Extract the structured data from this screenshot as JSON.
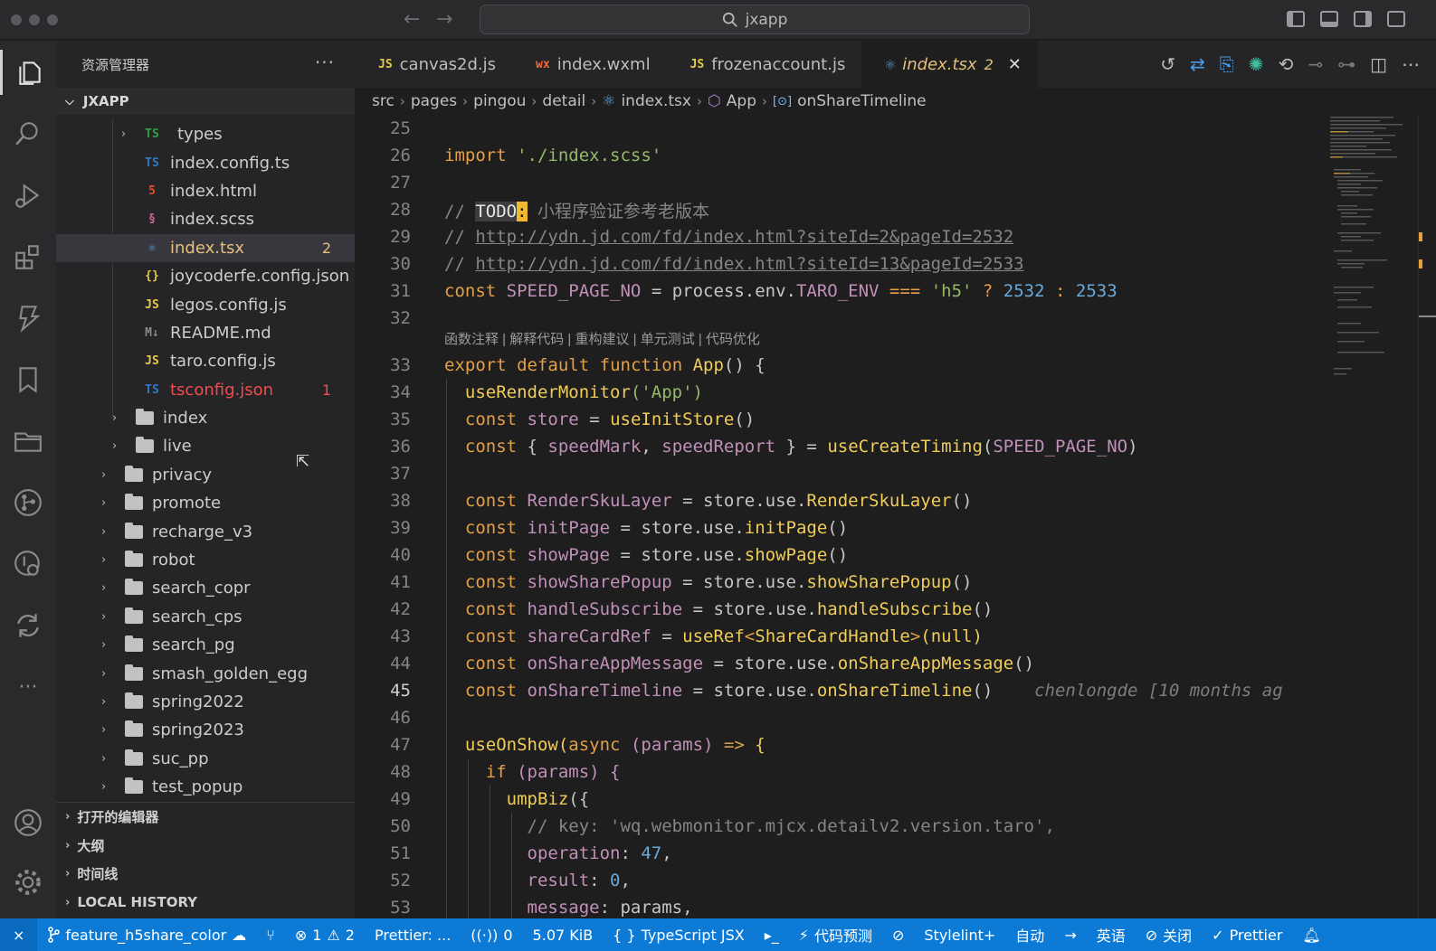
{
  "window": {
    "title": "jxapp"
  },
  "sidebar": {
    "title": "资源管理器",
    "more": "···",
    "root": "JXAPP",
    "items": [
      {
        "label": "types",
        "kind": "folder-ts",
        "icon": "TS",
        "color": "#cccccc"
      },
      {
        "label": "index.config.ts",
        "kind": "ts",
        "icon": "TS",
        "color": "#cccccc"
      },
      {
        "label": "index.html",
        "kind": "html",
        "icon": "5",
        "color": "#cccccc"
      },
      {
        "label": "index.scss",
        "kind": "scss",
        "icon": "§",
        "color": "#cccccc"
      },
      {
        "label": "index.tsx",
        "kind": "react",
        "icon": "⚛",
        "color": "#e5c07b",
        "badge": "2"
      },
      {
        "label": "joycoderfe.config.json",
        "kind": "json",
        "icon": "{}",
        "color": "#cccccc"
      },
      {
        "label": "legos.config.js",
        "kind": "js",
        "icon": "JS",
        "color": "#cccccc"
      },
      {
        "label": "README.md",
        "kind": "md",
        "icon": "M↓",
        "color": "#cccccc"
      },
      {
        "label": "taro.config.js",
        "kind": "js",
        "icon": "JS",
        "color": "#cccccc"
      },
      {
        "label": "tsconfig.json",
        "kind": "tsconfig",
        "icon": "TS",
        "color": "#f14c4c",
        "badge": "1"
      }
    ],
    "folders_l3": [
      "index",
      "live"
    ],
    "folders_l2": [
      "privacy",
      "promote",
      "recharge_v3",
      "robot",
      "search_copr",
      "search_cps",
      "search_pg",
      "smash_golden_egg",
      "spring2022",
      "spring2023",
      "suc_pp",
      "test_popup"
    ],
    "sections": [
      "打开的编辑器",
      "大纲",
      "时间线",
      "LOCAL HISTORY"
    ]
  },
  "tabs": [
    {
      "label": "canvas2d.js",
      "icon": "JS"
    },
    {
      "label": "index.wxml",
      "icon": "wx"
    },
    {
      "label": "frozenaccount.js",
      "icon": "JS"
    },
    {
      "label": "index.tsx",
      "icon": "⚛",
      "badge": "2",
      "active": true
    }
  ],
  "breadcrumb": [
    "src",
    "pages",
    "pingou",
    "detail",
    "index.tsx",
    "App",
    "onShareTimeline"
  ],
  "editor": {
    "codelens": "函数注释 | 解释代码 | 重构建议 | 单元测试 | 代码优化",
    "blame": "chenlongde [10 months ag",
    "line_numbers": [
      "25",
      "26",
      "27",
      "28",
      "29",
      "30",
      "31",
      "32",
      "33",
      "34",
      "35",
      "36",
      "37",
      "38",
      "39",
      "40",
      "41",
      "42",
      "43",
      "44",
      "45",
      "46",
      "47",
      "48",
      "49",
      "50",
      "51",
      "52",
      "53"
    ],
    "current_line": "45",
    "lines": {
      "l26": {
        "kw": "import",
        "str": "'./index.scss'"
      },
      "l28": {
        "cmt": "// ",
        "todo": "TODO",
        "colon": ":",
        "rest": " 小程序验证参考老版本"
      },
      "l29": {
        "cmt": "// ",
        "url": "http://ydn.jd.com/fd/index.html?siteId=2&pageId=2532"
      },
      "l30": {
        "cmt": "// ",
        "url": "http://ydn.jd.com/fd/index.html?siteId=13&pageId=2533"
      },
      "l31": {
        "kw": "const",
        "name": "SPEED_PAGE_NO",
        "eq": " = process.env.",
        "env": "TARO_ENV",
        "op": " === ",
        "str": "'h5'",
        "q": " ? ",
        "n1": "2532",
        "c": " : ",
        "n2": "2533"
      },
      "l33": {
        "kw1": "export",
        "kw2": "default",
        "kw3": "function",
        "fn": "App",
        "rest": "() {"
      },
      "l34": {
        "fn": "useRenderMonitor",
        "str": "('App')"
      },
      "l35": {
        "kw": "const",
        "var": "store",
        "eq": " = ",
        "fn": "useInitStore",
        "rest": "()"
      },
      "l36": {
        "kw": "const",
        "open": " { ",
        "v1": "speedMark",
        "comma": ", ",
        "v2": "speedReport",
        "close": " } = ",
        "fn": "useCreateTiming",
        "lp": "(",
        "arg": "SPEED_PAGE_NO",
        "rp": ")"
      },
      "l38": {
        "kw": "const",
        "var": "RenderSkuLayer",
        "eq": " = store.use.",
        "fn": "RenderSkuLayer",
        "rest": "()"
      },
      "l39": {
        "kw": "const",
        "var": "initPage",
        "eq": " = store.use.",
        "fn": "initPage",
        "rest": "()"
      },
      "l40": {
        "kw": "const",
        "var": "showPage",
        "eq": " = store.use.",
        "fn": "showPage",
        "rest": "()"
      },
      "l41": {
        "kw": "const",
        "var": "showSharePopup",
        "eq": " = store.use.",
        "fn": "showSharePopup",
        "rest": "()"
      },
      "l42": {
        "kw": "const",
        "var": "handleSubscribe",
        "eq": " = store.use.",
        "fn": "handleSubscribe",
        "rest": "()"
      },
      "l43": {
        "kw": "const",
        "var": "shareCardRef",
        "eq": " = ",
        "fn": "useRef",
        "lt": "<",
        "type": "ShareCardHandle",
        "gt": ">",
        "rest": "(null)"
      },
      "l44": {
        "kw": "const",
        "var": "onShareAppMessage",
        "eq": " = store.use.",
        "fn": "onShareAppMessage",
        "rest": "()"
      },
      "l45": {
        "kw": "const",
        "var": "onShareTimeline",
        "eq": " = store.use.",
        "fn": "onShareTimeline",
        "rest": "()"
      },
      "l47": {
        "fn": "useOnShow",
        "lp": "(",
        "kw": "async",
        "p1": " (params) ",
        "arrow": "=>",
        "rest": " {"
      },
      "l48": {
        "kw": "if",
        "rest": " (params) {"
      },
      "l49": {
        "fn": "umpBiz",
        "rest": "({"
      },
      "l50": {
        "cmt": "// key: 'wq.webmonitor.mjcx.detailv2.version.taro',"
      },
      "l51": {
        "key": "operation",
        "colon": ": ",
        "num": "47",
        "comma": ","
      },
      "l52": {
        "key": "result",
        "colon": ": ",
        "num": "0",
        "comma": ","
      },
      "l53": {
        "key": "message",
        "colon": ": ",
        "val": "params,"
      }
    }
  },
  "statusbar": {
    "remote": "⨯",
    "branch": "feature_h5share_color",
    "errors": "1",
    "warnings": "2",
    "prettier_status": "Prettier: ...",
    "ports": "0",
    "filesize": "5.07 KiB",
    "language": "TypeScript JSX",
    "codepredict": "代码预测",
    "stylelint": "Stylelint+",
    "auto": "自动",
    "lang_en": "英语",
    "close": "关闭",
    "prettier": "Prettier"
  }
}
